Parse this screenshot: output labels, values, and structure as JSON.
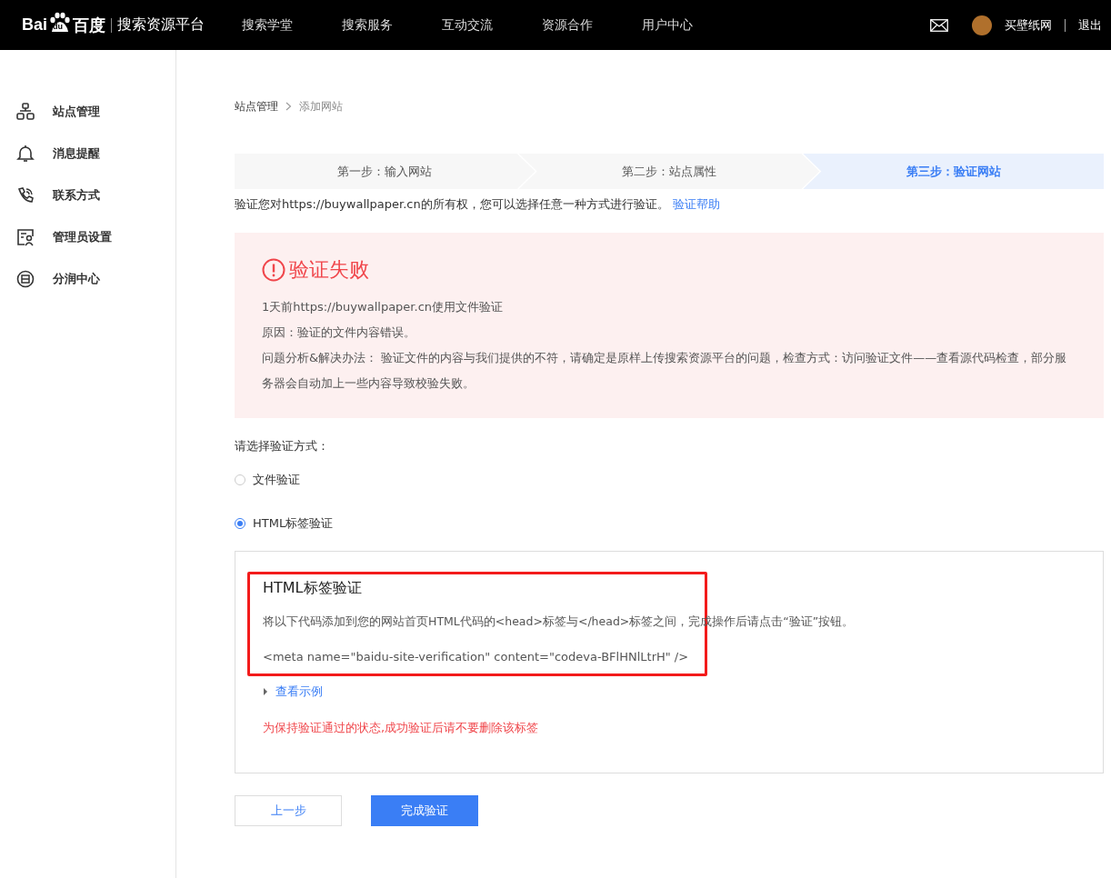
{
  "header": {
    "logo": {
      "text_left": "Bai",
      "paw_text": "du",
      "text_right": "百度",
      "product": "搜索资源平台"
    },
    "nav": [
      {
        "label": "搜索学堂",
        "selected": false
      },
      {
        "label": "搜索服务",
        "selected": false
      },
      {
        "label": "互动交流",
        "selected": false
      },
      {
        "label": "资源合作",
        "selected": false
      },
      {
        "label": "用户中心",
        "selected": false
      }
    ],
    "username": "买壁纸网",
    "logout": "退出"
  },
  "sidebar": {
    "items": [
      {
        "kind": "sitemap",
        "label": "站点管理"
      },
      {
        "kind": "bell",
        "label": "消息提醒"
      },
      {
        "kind": "phone",
        "label": "联系方式"
      },
      {
        "kind": "admin",
        "label": "管理员设置"
      },
      {
        "kind": "share",
        "label": "分润中心"
      }
    ]
  },
  "breadcrumb": [
    "站点管理",
    "添加网站"
  ],
  "steps": [
    {
      "label": "第一步：输入网站",
      "selected": false
    },
    {
      "label": "第二步：站点属性",
      "selected": false
    },
    {
      "label": "第三步：验证网站",
      "selected": true
    }
  ],
  "intro": {
    "text": "验证您对https://buywallpaper.cn的所有权，您可以选择任意一种方式进行验证。",
    "link": "验证帮助"
  },
  "alert": {
    "title": "验证失败",
    "lines": [
      "1天前https://buywallpaper.cn使用文件验证",
      "原因：验证的文件内容错误。",
      "问题分析&解决办法： 验证文件的内容与我们提供的不符，请确定是原样上传搜索资源平台的问题，检查方式：访问验证文件——查看源代码检查，部分服务器会自动加上一些内容导致校验失败。"
    ]
  },
  "method_prompt": "请选择验证方式：",
  "methods": [
    {
      "label": "文件验证",
      "selected": false
    },
    {
      "label": "HTML标签验证",
      "selected": true
    }
  ],
  "panel": {
    "title": "HTML标签验证",
    "instruction": "将以下代码添加到您的网站首页HTML代码的<head>标签与</head>标签之间，完成操作后请点击“验证”按钮。",
    "code": "<meta name=\"baidu-site-verification\" content=\"codeva-BFlHNlLtrH\" />",
    "example_link": "查看示例",
    "expanded": false,
    "warning": "为保持验证通过的状态,成功验证后请不要删除该标签",
    "highlighted": true
  },
  "buttons": [
    {
      "label": "上一步",
      "kind": "secondary"
    },
    {
      "label": "完成验证",
      "kind": "primary"
    }
  ]
}
